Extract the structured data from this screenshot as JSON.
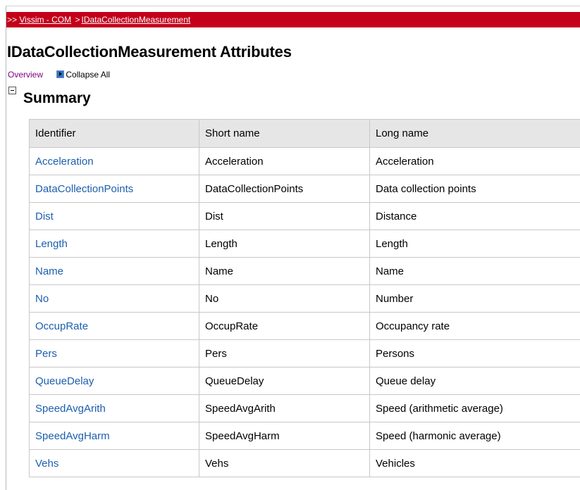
{
  "breadcrumb": {
    "prefix": ">>",
    "items": [
      "Vissim - COM",
      "IDataCollectionMeasurement"
    ],
    "separator": ">"
  },
  "page_title": "IDataCollectionMeasurement Attributes",
  "links": {
    "overview": "Overview",
    "collapse_all": "Collapse All"
  },
  "section": {
    "title": "Summary"
  },
  "table": {
    "headers": [
      "Identifier",
      "Short name",
      "Long name"
    ],
    "rows": [
      [
        "Acceleration",
        "Acceleration",
        "Acceleration"
      ],
      [
        "DataCollectionPoints",
        "DataCollectionPoints",
        "Data collection points"
      ],
      [
        "Dist",
        "Dist",
        "Distance"
      ],
      [
        "Length",
        "Length",
        "Length"
      ],
      [
        "Name",
        "Name",
        "Name"
      ],
      [
        "No",
        "No",
        "Number"
      ],
      [
        "OccupRate",
        "OccupRate",
        "Occupancy rate"
      ],
      [
        "Pers",
        "Pers",
        "Persons"
      ],
      [
        "QueueDelay",
        "QueueDelay",
        "Queue delay"
      ],
      [
        "SpeedAvgArith",
        "SpeedAvgArith",
        "Speed (arithmetic average)"
      ],
      [
        "SpeedAvgHarm",
        "SpeedAvgHarm",
        "Speed (harmonic average)"
      ],
      [
        "Vehs",
        "Vehs",
        "Vehicles"
      ]
    ]
  },
  "colors": {
    "breadcrumb_bg": "#c4001a",
    "link": "#1c5fae",
    "visited_link": "#800080",
    "header_bg": "#e6e6e6"
  }
}
